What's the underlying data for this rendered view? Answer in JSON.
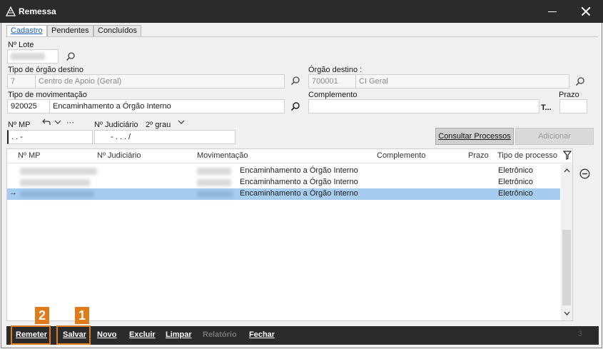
{
  "window": {
    "title": "Remessa"
  },
  "tabs": [
    {
      "label": "Cadastro"
    },
    {
      "label": "Pendentes"
    },
    {
      "label": "Concluídos"
    }
  ],
  "form": {
    "lote_label": "Nº Lote",
    "tipo_orgao_label": "Tipo de órgão destino",
    "tipo_orgao_code": "7",
    "tipo_orgao_name": "Centro de Apoio (Geral)",
    "orgao_label": "Órgão destino :",
    "orgao_code": "700001",
    "orgao_name": "CI Geral",
    "tipo_mov_label": "Tipo de movimentação",
    "tipo_mov_code": "920025",
    "tipo_mov_name": "Encaminhamento a Órgão Interno",
    "complemento_label": "Complemento",
    "complemento_btn": "T...",
    "prazo_label": "Prazo",
    "mp_label": "Nº MP",
    "mp_mask": ". .     -",
    "judiciario_label": "Nº Judiciário",
    "grau": "2º grau",
    "judiciario_mask": "-  .  .  .  /"
  },
  "actions": {
    "consultar": "Consultar Processos",
    "adicionar": "Adicionar"
  },
  "grid": {
    "columns": [
      "Nº MP",
      "Nº Judiciário",
      "Movimentação",
      "Complemento",
      "Prazo",
      "Tipo de processo"
    ],
    "rows": [
      {
        "movimentacao": "Encaminhamento a Órgão Interno",
        "tipo": "Eletrônico"
      },
      {
        "movimentacao": "Encaminhamento a Órgão Interno",
        "tipo": "Eletrônico"
      },
      {
        "movimentacao": "Encaminhamento a Órgão Interno",
        "tipo": "Eletrônico",
        "selected": true
      }
    ]
  },
  "toolbar": {
    "remeter": "Remeter",
    "salvar": "Salvar",
    "novo": "Novo",
    "excluir": "Excluir",
    "limpar": "Limpar",
    "relatorio": "Relatório",
    "fechar": "Fechar",
    "count": "3"
  },
  "annotations": {
    "badge_remeter": "2",
    "badge_salvar": "1"
  },
  "colors": {
    "accent": "#e07b1a",
    "selection": "#a6cdf0",
    "titlebar": "#2b2b2b"
  }
}
